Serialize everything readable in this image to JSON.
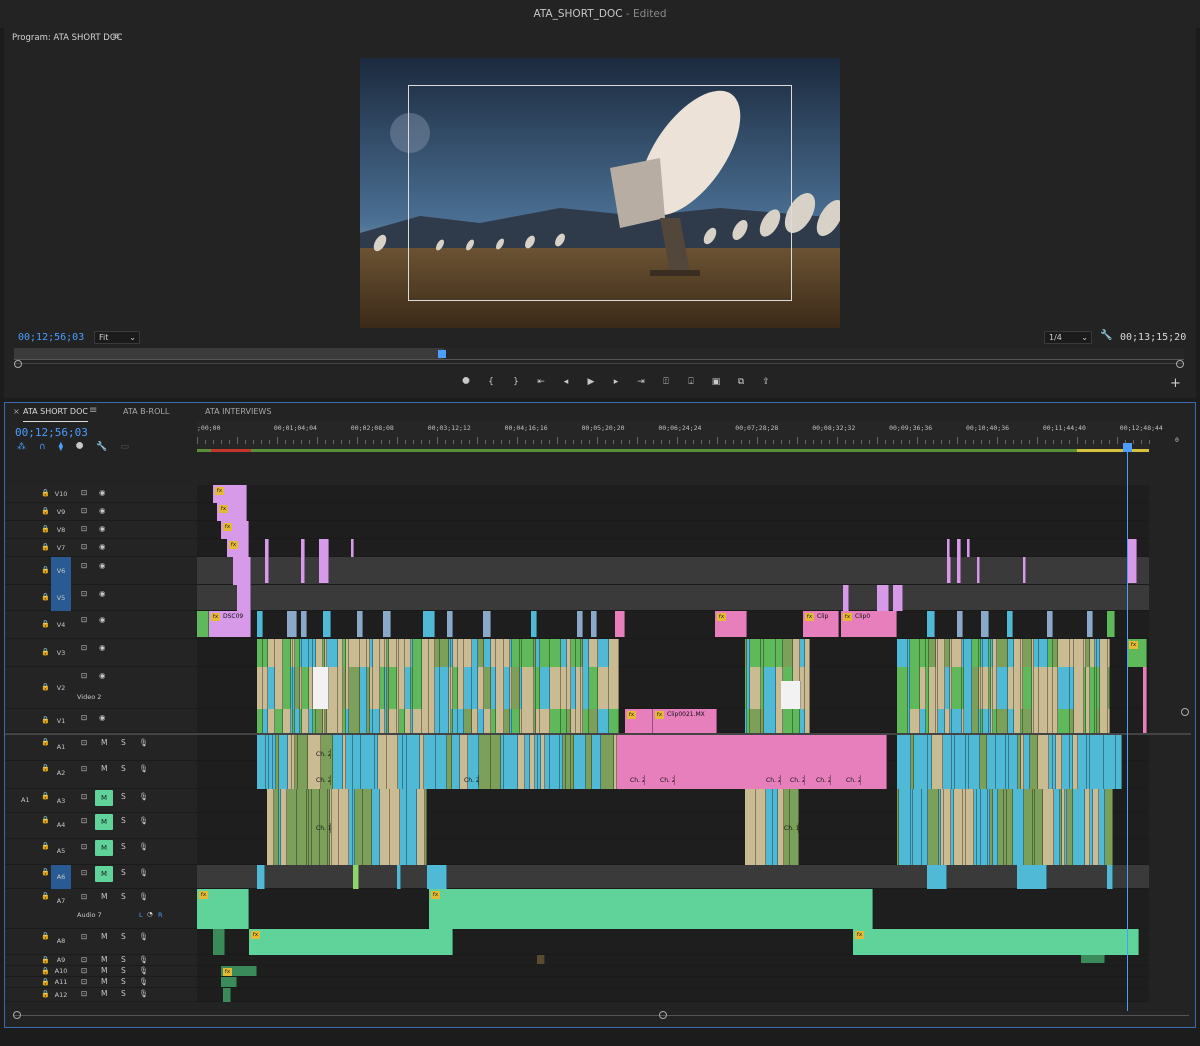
{
  "window": {
    "title": "ATA_SHORT_DOC",
    "edited": "- Edited"
  },
  "program_monitor": {
    "title": "Program: ATA SHORT DOC",
    "menu_icon": "hamburger-menu-icon",
    "timecode_in": "00;12;56;03",
    "fit": "Fit",
    "resolution": "1/4",
    "timecode_duration": "00;13;15;20"
  },
  "transport": [
    "marker-icon",
    "mark-in-icon",
    "mark-out-icon",
    "go-to-in-icon",
    "step-back-icon",
    "play-icon",
    "step-forward-icon",
    "go-to-out-icon",
    "lift-icon",
    "extract-icon",
    "camera-icon",
    "insert-icon",
    "export-icon"
  ],
  "timeline": {
    "tabs": [
      "ATA SHORT DOC",
      "ATA B-ROLL",
      "ATA INTERVIEWS"
    ],
    "close": "×",
    "timecode": "00;12;56;03",
    "ruler": [
      ";00;00",
      "00;01;04;04",
      "00;02;08;08",
      "00;03;12;12",
      "00;04;16;16",
      "00;05;20;20",
      "00;06;24;24",
      "00;07;28;28",
      "00;08;32;32",
      "00;09;36;36",
      "00;10;40;36",
      "00;11;44;40",
      "00;12;48;44"
    ],
    "ruler_end": "0",
    "video_tracks": [
      "V10",
      "V9",
      "V8",
      "V7",
      "V6",
      "V5",
      "V4",
      "V3",
      "V2",
      "V1"
    ],
    "video2_label": "Video 2",
    "audio_tracks": [
      "A1",
      "A2",
      "A3",
      "A4",
      "A5",
      "A6",
      "A7",
      "A8",
      "A9",
      "A10",
      "A11",
      "A12"
    ],
    "audio7_label": "Audio 7",
    "a1_source": "A1",
    "lr": "L",
    "lr2": "R",
    "m": "M",
    "s": "S",
    "clip_labels": {
      "dsc": "DSC09",
      "clip": "Clip",
      "clip0": "Clip0",
      "clip21": "Clip0021.MX",
      "ch2": "Ch. 2",
      "ch1": "Ch. 1",
      "fx": "fx"
    }
  },
  "colors": {
    "accent": "#4b9dff",
    "pink": "#e77fbd",
    "violet": "#d79ae9",
    "green": "#5fb85a",
    "teal": "#4fb9d6",
    "tan": "#cbbb92",
    "audio": "#5fd39a"
  }
}
